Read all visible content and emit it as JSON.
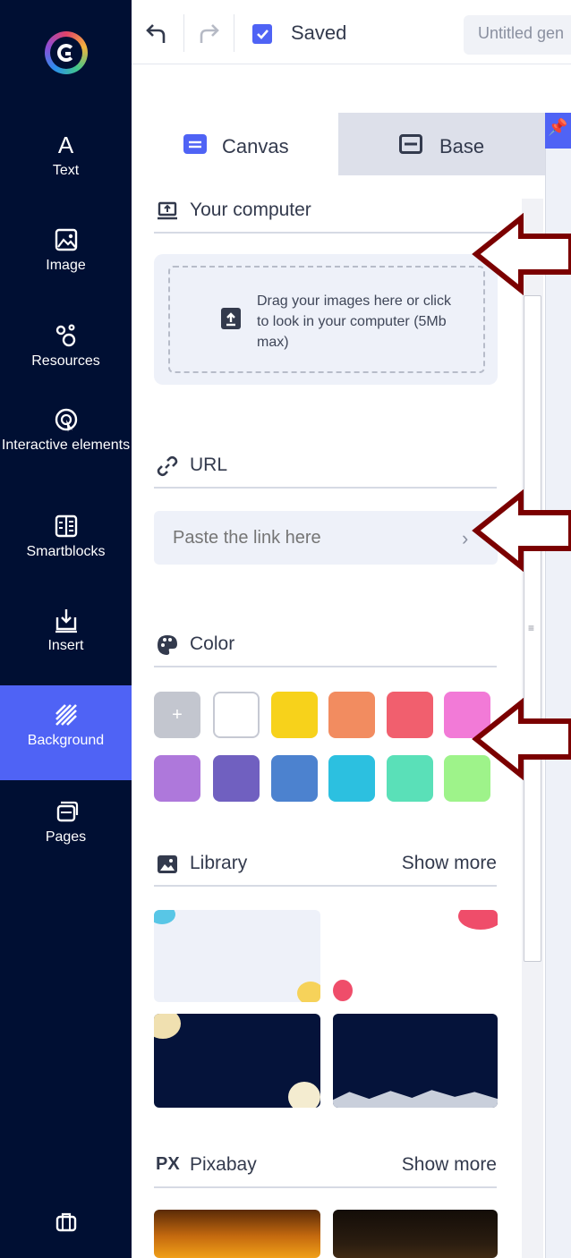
{
  "sidebar": {
    "items": [
      {
        "label": "Text",
        "icon": "text-icon"
      },
      {
        "label": "Image",
        "icon": "image-icon"
      },
      {
        "label": "Resources",
        "icon": "resources-icon"
      },
      {
        "label": "Interactive elements",
        "icon": "interactive-icon"
      },
      {
        "label": "Smartblocks",
        "icon": "smartblocks-icon"
      },
      {
        "label": "Insert",
        "icon": "insert-icon"
      },
      {
        "label": "Background",
        "icon": "background-icon",
        "active": true
      },
      {
        "label": "Pages",
        "icon": "pages-icon"
      }
    ],
    "bottom_icon": "briefcase-icon"
  },
  "topbar": {
    "saved_label": "Saved",
    "doc_title": "Untitled gen"
  },
  "tabs": [
    {
      "label": "Canvas",
      "active": true
    },
    {
      "label": "Base",
      "active": false
    }
  ],
  "sections": {
    "computer": {
      "title": "Your computer",
      "drop_text": "Drag your images here or click to look in your computer (5Mb max)"
    },
    "url": {
      "title": "URL",
      "placeholder": "Paste the link here"
    },
    "color": {
      "title": "Color",
      "add_label": "+",
      "swatches": [
        "#ffffff",
        "#f7d21b",
        "#f28c60",
        "#f15f6e",
        "#f27ad7",
        "#ae78db",
        "#7060c0",
        "#4c82cf",
        "#2cc0e0",
        "#5ae0b8",
        "#9ef38a"
      ]
    },
    "library": {
      "title": "Library",
      "show_more": "Show more"
    },
    "pixabay": {
      "title": "Pixabay",
      "logo_text": "PX",
      "show_more": "Show more"
    }
  },
  "colors": {
    "sidebar_bg": "#000f33",
    "accent": "#4f63f5",
    "arrow": "#7b0000"
  }
}
